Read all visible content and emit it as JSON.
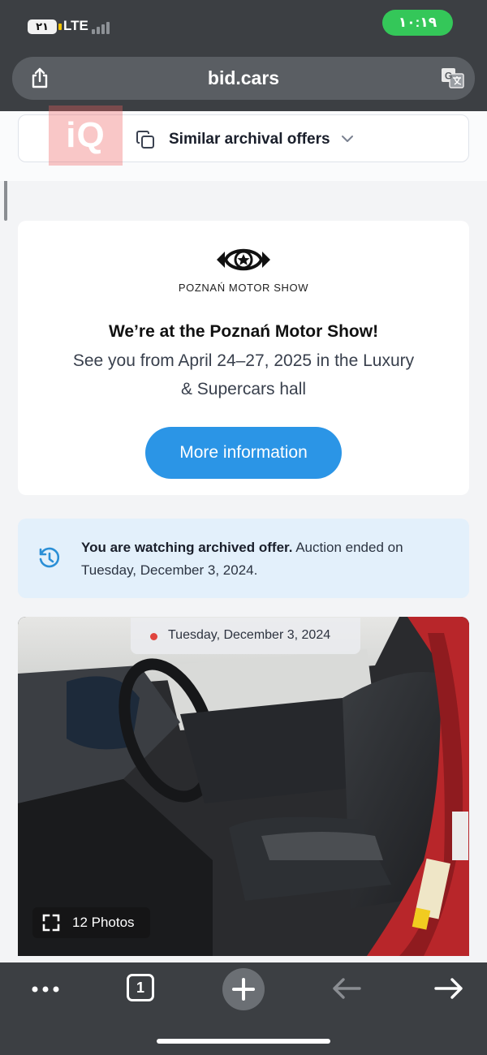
{
  "status_bar": {
    "sim_label": "٢١",
    "network": "LTE",
    "time": "١٠:١٩"
  },
  "browser": {
    "url": "bid.cars",
    "tab_count": "1"
  },
  "similar_offers": {
    "label": "Similar archival offers"
  },
  "watermark": {
    "text": "iQ"
  },
  "motor_show": {
    "logo_text": "POZNAŃ MOTOR SHOW",
    "title": "We’re at the Poznań Motor Show!",
    "subtitle": "See you from April 24–27, 2025 in the Luxury & Supercars hall",
    "button_label": "More information"
  },
  "archived_notice": {
    "bold_text": "You are watching archived offer.",
    "text": " Auction ended on Tuesday, December 3, 2024."
  },
  "photo": {
    "date": "Tuesday, December 3, 2024",
    "photos_count_label": "12 Photos"
  },
  "colors": {
    "accent": "#2b95e6",
    "chrome": "#3c3f43",
    "clock_green": "#34c759",
    "notice_bg": "#e3f0fb",
    "live_dot": "#e0443d"
  },
  "icons": [
    "share-icon",
    "translate-icon",
    "copy-icon",
    "chevron-down-icon",
    "poznan-logo-icon",
    "history-icon",
    "expand-icon",
    "more-icon",
    "tabs-icon",
    "plus-icon",
    "back-arrow-icon",
    "forward-arrow-icon"
  ]
}
